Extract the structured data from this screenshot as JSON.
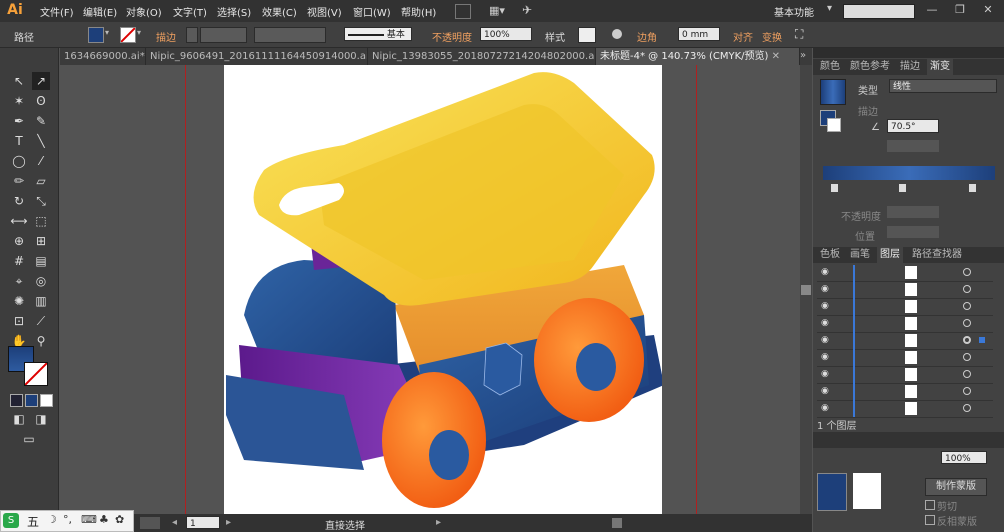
{
  "app": {
    "logo": "Ai"
  },
  "menu": [
    "文件(F)",
    "编辑(E)",
    "对象(O)",
    "文字(T)",
    "选择(S)",
    "效果(C)",
    "视图(V)",
    "窗口(W)",
    "帮助(H)"
  ],
  "workspace": "基本功能",
  "control_bar": {
    "object_label": "路径",
    "stroke_label": "描边",
    "stroke_style": "基本",
    "opacity_label": "不透明度",
    "opacity_value": "100%",
    "style_label": "样式",
    "corner_label": "边角",
    "corner_value": "0 mm",
    "align_label": "对齐",
    "transform_label": "变换"
  },
  "doc_tabs": [
    {
      "title": "1634669000.ai*",
      "active": false
    },
    {
      "title": "Nipic_9606491_20161111164450914000.ai*",
      "active": false
    },
    {
      "title": "Nipic_13983055_20180727214204802000.ai*",
      "active": false
    },
    {
      "title": "未标题-4* @ 140.73% (CMYK/预览)",
      "active": true
    }
  ],
  "gradient_panel": {
    "tabs": [
      "颜色",
      "颜色参考",
      "描边",
      "渐变"
    ],
    "type_label": "类型",
    "type_value": "线性",
    "stroke_label": "描边",
    "angle_value": "70.5°",
    "opacity_label": "不透明度",
    "position_label": "位置"
  },
  "layers_panel": {
    "tabs": [
      "色板",
      "画笔",
      "图层",
      "路径查找器"
    ],
    "footer": "1 个图层",
    "rows": 9
  },
  "bottom_panel": {
    "mask_button": "制作蒙版",
    "clip_label": "剪切",
    "invert_label": "反相蒙版",
    "opacity_value": "100%"
  },
  "status": {
    "zoom": "140.73%",
    "page": "1",
    "tool_name": "直接选择"
  },
  "ime": {
    "label": "五"
  },
  "colors": {
    "accent_orange": "#f0a060",
    "fill_blue": "#1d3f7a",
    "guide_red": "#b02020"
  }
}
